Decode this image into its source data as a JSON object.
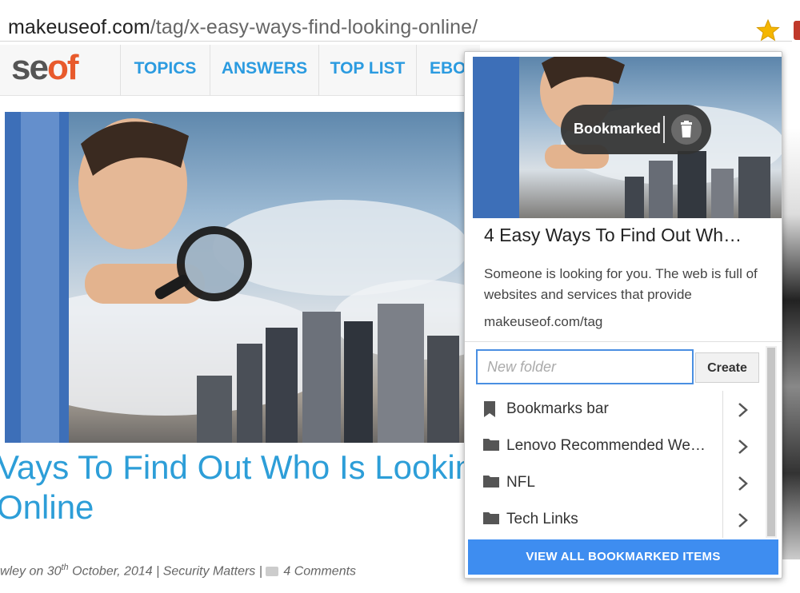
{
  "browser": {
    "url_domain": "makeuseof.com",
    "url_path": "/tag/x-easy-ways-find-looking-online/",
    "star_color": "#f5b600"
  },
  "site": {
    "logo_prefix": "se",
    "logo_suffix": "of",
    "nav": [
      "TOPICS",
      "ANSWERS",
      "TOP LIST",
      "EBOO"
    ],
    "accent": "#2b9be0"
  },
  "article": {
    "title_line1": "Vays To Find Out Who Is Lookin",
    "title_line2": "Online",
    "meta_author": "wley on 30",
    "meta_sup": "th",
    "meta_date": " October, 2014 | ",
    "meta_category": "Security Matters",
    "meta_sep": " | ",
    "meta_comments": "4 Comments"
  },
  "popup": {
    "status_label": "Bookmarked",
    "title": "4 Easy Ways To Find Out Wh…",
    "description": "Someone is looking for you. The web is full of websites and services that provide",
    "url": "makeuseof.com/tag",
    "folder_input_placeholder": "New folder",
    "create_label": "Create",
    "folders": [
      {
        "label": "Bookmarks bar",
        "icon": "bookmark-icon"
      },
      {
        "label": "Lenovo Recommended We…",
        "icon": "folder-icon"
      },
      {
        "label": "NFL",
        "icon": "folder-icon"
      },
      {
        "label": "Tech Links",
        "icon": "folder-icon"
      }
    ],
    "view_all_label": "VIEW ALL BOOKMARKED ITEMS",
    "view_all_color": "#3e8df0"
  }
}
